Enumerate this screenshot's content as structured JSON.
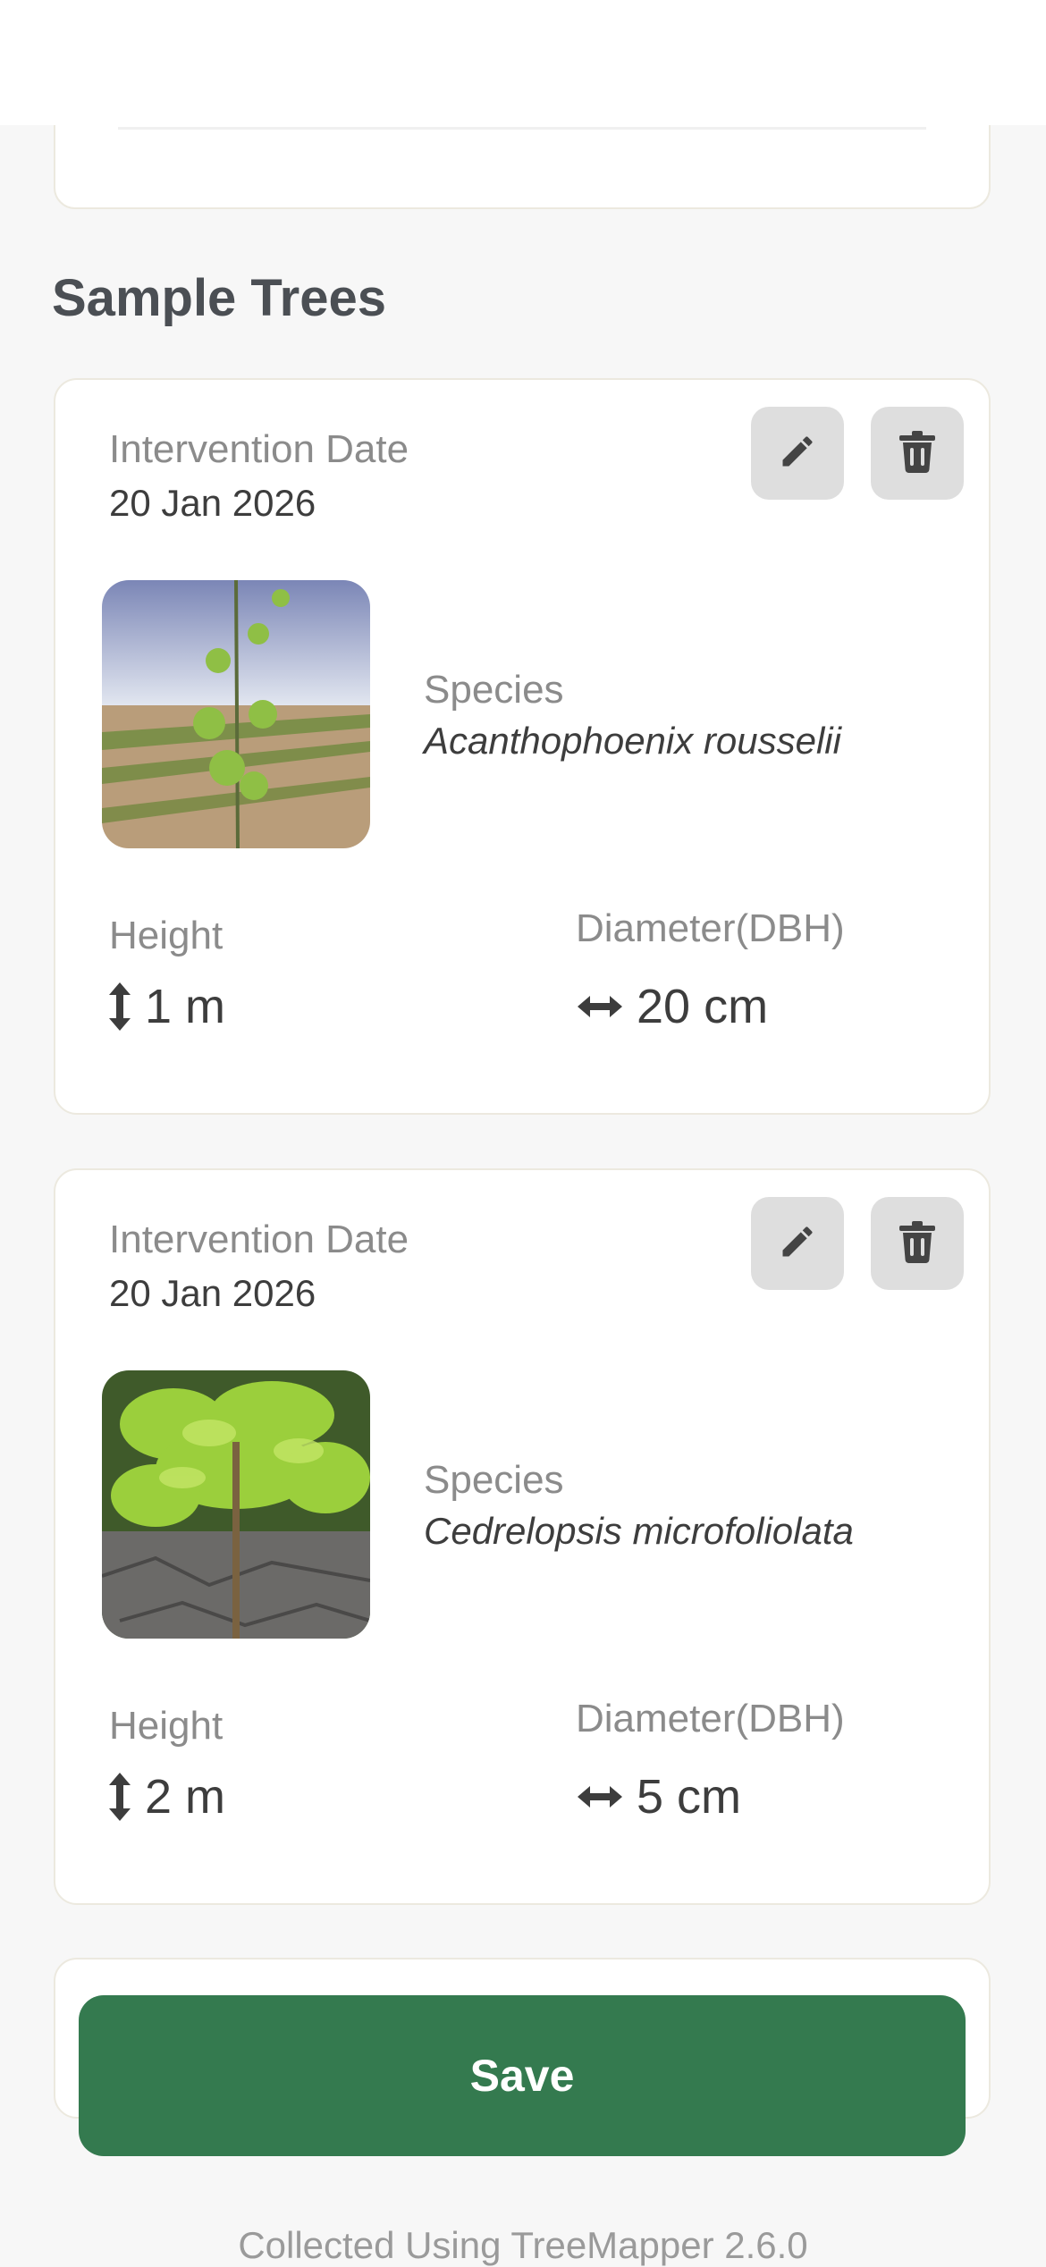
{
  "section_title": "Sample Trees",
  "labels": {
    "intervention_date": "Intervention Date",
    "species": "Species",
    "height": "Height",
    "diameter": "Diameter(DBH)"
  },
  "trees": [
    {
      "date": "20 Jan 2026",
      "species": "Acanthophoenix rousselii",
      "height": "1 m",
      "diameter": "20 cm",
      "photo": "sapling-in-field-photo"
    },
    {
      "date": "20 Jan 2026",
      "species": "Cedrelopsis microfoliolata",
      "height": "2 m",
      "diameter": "5 cm",
      "photo": "leafy-sapling-photo"
    }
  ],
  "actions": {
    "edit_icon": "pencil-icon",
    "delete_icon": "trash-icon"
  },
  "save_button": "Save",
  "footer": "Collected Using TreeMapper 2.6.0",
  "colors": {
    "primary": "#347a4f",
    "card_border": "#ece9df",
    "icon_button_bg": "#dedede"
  }
}
